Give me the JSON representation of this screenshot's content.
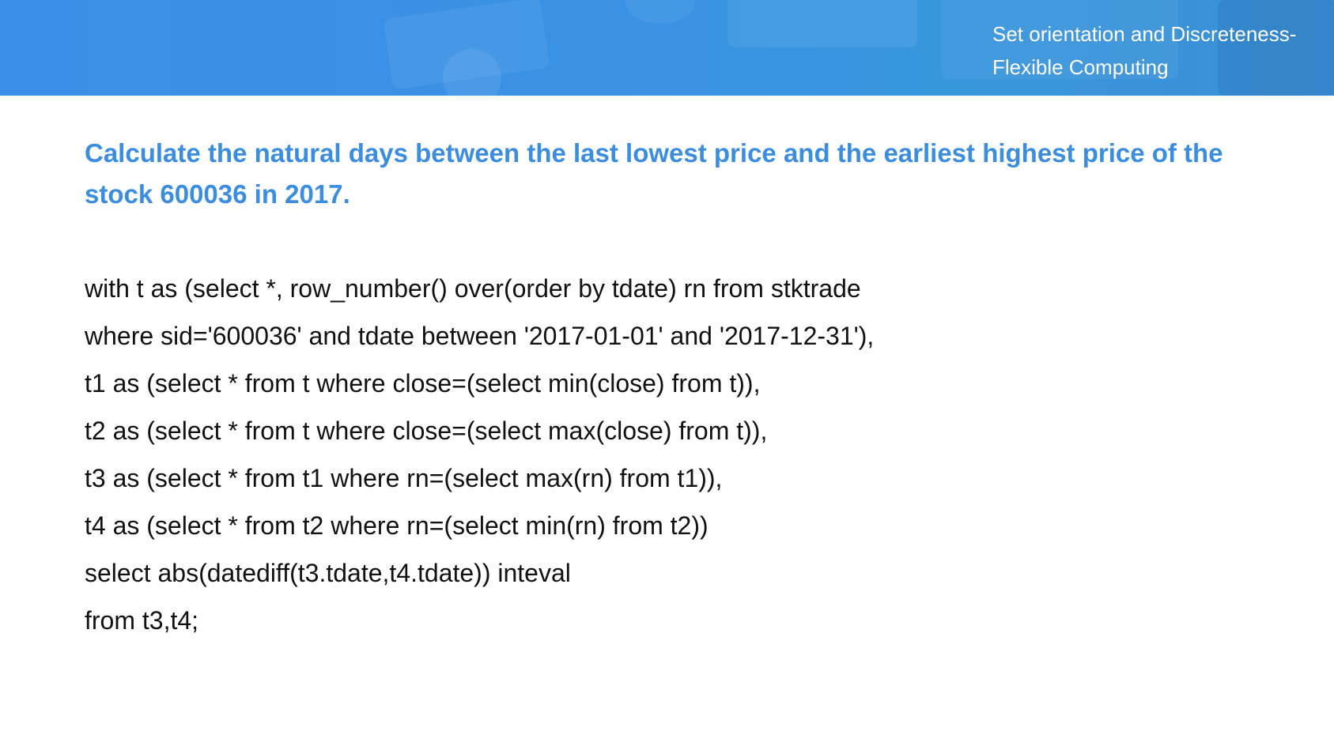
{
  "header": {
    "title_line1": "Set orientation and Discreteness-",
    "title_line2": "Flexible Computing",
    "banner_color": "#3a92e4"
  },
  "heading": {
    "text": "Calculate the natural days between the last lowest price and the earliest highest price of the stock 600036 in 2017.",
    "color": "#3b8de0"
  },
  "code": {
    "lines": [
      "with t as (select *, row_number() over(order by tdate) rn from stktrade",
      "where sid='600036' and tdate between '2017-01-01' and '2017-12-31'),",
      "t1 as (select * from t where close=(select min(close) from t)),",
      "t2 as (select * from t where close=(select max(close) from t)),",
      "t3 as (select * from t1 where rn=(select max(rn) from t1)),",
      "t4 as (select * from t2 where rn=(select min(rn) from t2))",
      "select abs(datediff(t3.tdate,t4.tdate)) inteval",
      "from t3,t4;"
    ]
  }
}
